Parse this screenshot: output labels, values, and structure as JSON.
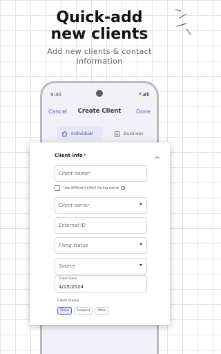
{
  "promo": {
    "headline_line1": "Quick-add",
    "headline_line2": "new clients",
    "subtitle_line1": "Add new clients & contact",
    "subtitle_line2": "information"
  },
  "device": {
    "time": "9:30",
    "status_icons": "▾◢▮"
  },
  "navbar": {
    "cancel": "Cancel",
    "title": "Create Client",
    "done": "Done"
  },
  "segments": {
    "individual": "Individual",
    "business": "Business"
  },
  "form": {
    "section_title": "Client info",
    "required_marker": "*",
    "client_name_placeholder": "Client name*",
    "checkbox_label": "Use different client facing name",
    "client_owner_placeholder": "Client owner",
    "external_id_placeholder": "External ID",
    "filing_status_placeholder": "Filing status",
    "source_placeholder": "Source",
    "client_since_label": "Client Since",
    "client_since_value": "4/15/2024",
    "client_status_label": "Client status",
    "status_options": [
      "Client",
      "Prospect",
      "Other"
    ],
    "selected_status": "Client"
  },
  "colors": {
    "accent": "#5a5fc4",
    "background": "#ffffff",
    "grid": "#e3e3e6"
  }
}
